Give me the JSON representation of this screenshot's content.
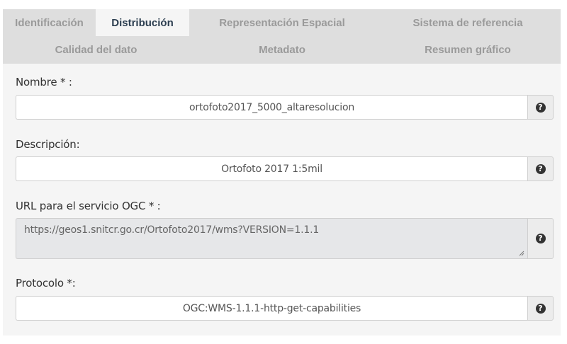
{
  "tabs": {
    "row1": [
      "Identificación",
      "Distribución",
      "Representación Espacial",
      "Sistema de referencia"
    ],
    "row2": [
      "Calidad del dato",
      "Metadato",
      "Resumen gráfico"
    ],
    "active": "Distribución"
  },
  "fields": {
    "nombre": {
      "label": "Nombre * :",
      "value": "ortofoto2017_5000_altaresolucion"
    },
    "descripcion": {
      "label": "Descripción:",
      "value": "Ortofoto 2017 1:5mil"
    },
    "url": {
      "label": "URL para el servicio OGC * :",
      "value": "https://geos1.snitcr.go.cr/Ortofoto2017/wms?VERSION=1.1.1"
    },
    "protocolo": {
      "label": "Protocolo *:",
      "value": "OGC:WMS-1.1.1-http-get-capabilities"
    }
  },
  "help_glyph": "?",
  "colors": {
    "active_tab_text": "#2c3e50",
    "inactive_tab_text": "#9a9a9a",
    "tab_bar": "#dedede",
    "panel": "#f5f5f5",
    "disabled_field": "#e6e7e9"
  }
}
